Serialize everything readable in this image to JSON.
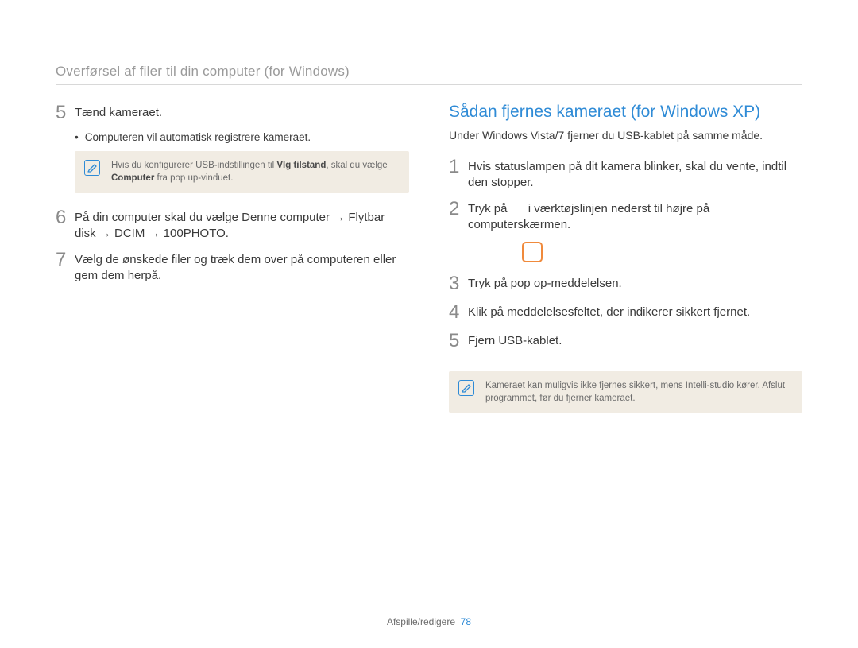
{
  "header": {
    "title": "Overførsel af filer til din computer (for Windows)"
  },
  "left": {
    "step5": {
      "num": "5",
      "text": "Tænd kameraet."
    },
    "bullet5": "Computeren vil automatisk registrere kameraet.",
    "note5": {
      "pre": "Hvis du konfigurerer USB-indstillingen til ",
      "mode": "Vlg tilstand",
      "mid": ", skal du vælge ",
      "target": "Computer",
      "post": " fra pop up-vinduet."
    },
    "step6": {
      "num": "6",
      "parts": {
        "a": "På din computer skal du vælge Denne computer ",
        "arrow1": "→",
        "b": " Flytbar disk ",
        "arrow2": "→",
        "c": " DCIM ",
        "arrow3": "→",
        "d": " 100PHOTO."
      }
    },
    "step7": {
      "num": "7",
      "text": "Vælg de ønskede filer og træk dem over på computeren eller gem dem herpå."
    }
  },
  "right": {
    "title": "Sådan fjernes kameraet (for Windows XP)",
    "subtitle": "Under Windows Vista/7 fjerner du USB-kablet på samme måde.",
    "step1": {
      "num": "1",
      "text": "Hvis statuslampen på dit kamera blinker, skal du vente, indtil den stopper."
    },
    "step2": {
      "num": "2",
      "pre": "Tryk på ",
      "post": " i værktøjslinjen nederst til højre på computerskærmen."
    },
    "step3": {
      "num": "3",
      "text": "Tryk på pop op-meddelelsen."
    },
    "step4": {
      "num": "4",
      "text": "Klik på meddelelsesfeltet, der indikerer sikkert fjernet."
    },
    "step5": {
      "num": "5",
      "text": "Fjern USB-kablet."
    },
    "note": "Kameraet kan muligvis ikke fjernes sikkert, mens Intelli-studio kører. Afslut programmet, før du fjerner kameraet."
  },
  "footer": {
    "section": "Afspille/redigere",
    "page": "78"
  }
}
